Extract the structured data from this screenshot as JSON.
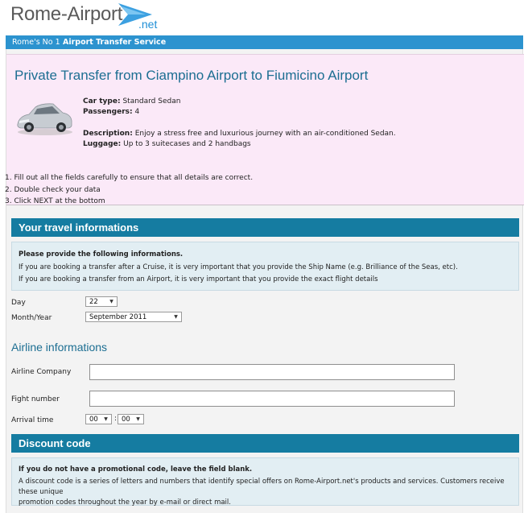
{
  "brand": {
    "logo_main": "Rome-Airport",
    "logo_tld": ".net",
    "tagline_prefix": "Rome's No 1",
    "tagline_rest": "Airport Transfer Service"
  },
  "product": {
    "title": "Private Transfer from Ciampino Airport to Fiumicino Airport",
    "car_type_label": "Car type:",
    "car_type_value": "Standard Sedan",
    "passengers_label": "Passengers:",
    "passengers_value": "4",
    "description_label": "Description:",
    "description_value": "Enjoy a stress free and luxurious journey with an air-conditioned Sedan.",
    "luggage_label": "Luggage:",
    "luggage_value": "Up to 3 suitecases and 2 handbags"
  },
  "steps": [
    "1. Fill out all the fields carefully to ensure that all details are correct.",
    "2. Double check your data",
    "3. Click NEXT at the bottom"
  ],
  "travel": {
    "heading": "Your travel informations",
    "info_title": "Please provide the following informations.",
    "info_line1": "If you are booking a transfer after a Cruise, it is very important that you provide the Ship Name (e.g. Brilliance of the Seas, etc).",
    "info_line2": "If you are booking a transfer from an Airport, it is very important that you provide the exact flight details",
    "day_label": "Day",
    "day_value": "22",
    "month_label": "Month/Year",
    "month_value": "September 2011"
  },
  "airline": {
    "heading": "Airline informations",
    "company_label": "Airline Company",
    "company_value": "",
    "flight_label": "Fight number",
    "flight_value": "",
    "arrival_label": "Arrival time",
    "hour_value": "00",
    "minute_value": "00",
    "separator": ":"
  },
  "discount": {
    "heading": "Discount code",
    "info_title": "If you do not have a promotional code, leave the field blank.",
    "info_line1": "A discount code is a series of letters and numbers that identify special offers on Rome-Airport.net's products and services. Customers receive these unique",
    "info_line2": "promotion codes throughout the year by e-mail or direct mail."
  },
  "colors": {
    "brand_blue": "#2c93cf",
    "section_teal": "#157ca1",
    "title_blue": "#1c6e92",
    "product_bg": "#fbe9f8",
    "info_bg": "#e2eef3"
  },
  "icons": {
    "logo": "airplane-arrow-icon",
    "dropdown": "chevron-down-icon"
  }
}
